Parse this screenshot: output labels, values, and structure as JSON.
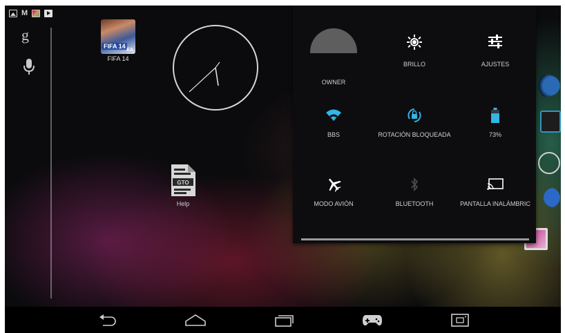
{
  "status_bar": {
    "icons": [
      "gallery-icon",
      "gmail-icon",
      "app-notification-icon",
      "play-store-icon"
    ],
    "gmail_glyph": "M"
  },
  "search": {
    "google_glyph": "g"
  },
  "home": {
    "fifa_label": "FIFA 14",
    "fifa_icon_text": "FIFA 14",
    "fifa_icon_badge": "EA",
    "help_label": "Help",
    "help_icon_text": "GTO"
  },
  "quick_settings": {
    "owner_label": "OWNER",
    "brightness_label": "BRILLO",
    "settings_label": "AJUSTES",
    "wifi_label": "BBS",
    "rotation_label": "ROTACIÓN BLOQUEADA",
    "battery_label": "73%",
    "battery_level": 0.73,
    "airplane_label": "MODO AVIÓN",
    "bluetooth_label": "BLUETOOTH",
    "cast_label": "PANTALLA INALÁMBRIC",
    "accent_color": "#33b5e5"
  },
  "nav_bar": {
    "buttons": [
      "back-icon",
      "home-icon",
      "recents-icon",
      "gamepad-icon",
      "screenshot-icon"
    ]
  }
}
